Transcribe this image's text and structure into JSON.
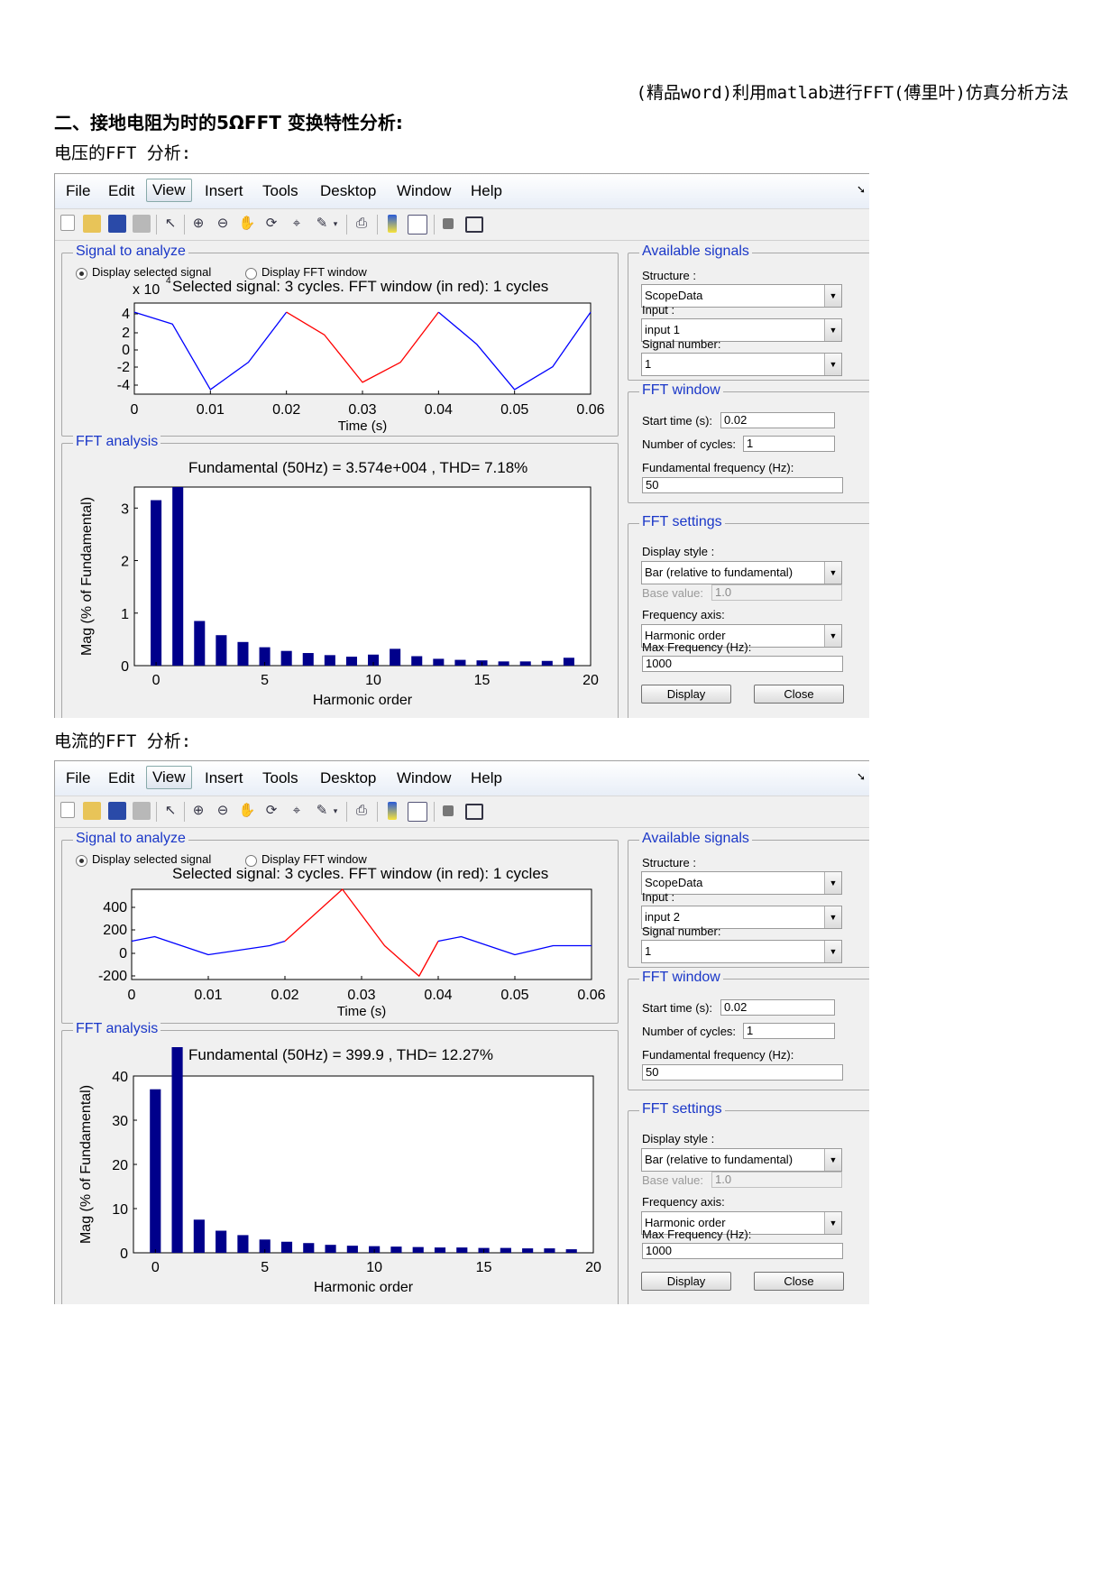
{
  "doc": {
    "header": "(精品word)利用matlab进行FFT(傅里叶)仿真分析方法",
    "heading": "二、接地电阻为时的5ΩFFT 变换特性分析:",
    "captions": [
      "电压的FFT 分析:",
      "电流的FFT 分析:"
    ]
  },
  "common": {
    "menus": [
      "File",
      "Edit",
      "View",
      "Insert",
      "Tools",
      "Desktop",
      "Window",
      "Help"
    ],
    "selected_menu": "View",
    "signal_group": "Signal to analyze",
    "radio_selected": "Display selected signal",
    "radio_fft": "Display FFT window",
    "fft_group": "FFT analysis",
    "available_group": "Available signals",
    "structure_label": "Structure :",
    "input_label": "Input :",
    "signal_number_label": "Signal number:",
    "fft_window_group": "FFT window",
    "start_time_label": "Start time (s):",
    "cycles_label": "Number of cycles:",
    "fund_freq_label": "Fundamental frequency (Hz):",
    "fft_settings_group": "FFT settings",
    "display_style_label": "Display style :",
    "base_value_label": "Base value:",
    "freq_axis_label": "Frequency axis:",
    "max_freq_label": "Max Frequency (Hz):",
    "display_button": "Display",
    "close_button": "Close",
    "time_xlabel": "Time (s)",
    "harm_xlabel": "Harmonic order",
    "harm_ylabel": "Mag (% of Fundamental)",
    "time_ticks": [
      "0",
      "0.01",
      "0.02",
      "0.03",
      "0.04",
      "0.05",
      "0.06"
    ],
    "harm_ticks": [
      "0",
      "5",
      "10",
      "15",
      "20"
    ]
  },
  "windows": [
    {
      "selected_text": "Selected signal: 3 cycles. FFT window (in red): 1 cycles",
      "y_scale_label": "x 10",
      "y_scale_exp": "4",
      "fundamental_text": "Fundamental (50Hz) = 3.574e+004 , THD= 7.18%",
      "structure": "ScopeData",
      "input": "input 1",
      "signal_number": "1",
      "start_time": "0.02",
      "cycles": "1",
      "fund_freq": "50",
      "display_style": "Bar (relative to fundamental)",
      "base_value": "1.0",
      "freq_axis": "Harmonic order",
      "max_freq": "1000"
    },
    {
      "selected_text": "Selected signal: 3 cycles. FFT window (in red): 1 cycles",
      "y_scale_label": "",
      "y_scale_exp": "",
      "fundamental_text": "Fundamental (50Hz) = 399.9 , THD= 12.27%",
      "structure": "ScopeData",
      "input": "input 2",
      "signal_number": "1",
      "start_time": "0.02",
      "cycles": "1",
      "fund_freq": "50",
      "display_style": "Bar (relative to fundamental)",
      "base_value": "1.0",
      "freq_axis": "Harmonic order",
      "max_freq": "1000"
    }
  ],
  "chart_data": [
    {
      "type": "line",
      "title": "Selected signal: 3 cycles. FFT window (in red): 1 cycles",
      "xlabel": "Time (s)",
      "ylabel": "",
      "xlim": [
        0,
        0.06
      ],
      "ylim": [
        -5,
        5
      ],
      "yticks": [
        "4",
        "2",
        "0",
        "-2",
        "-4"
      ],
      "y_multiplier": "x 10^4",
      "series": [
        {
          "color": "#0000ff",
          "x": [
            0,
            0.005,
            0.01,
            0.015,
            0.02
          ],
          "y": [
            4,
            2.7,
            -4.5,
            -1.5,
            4
          ]
        },
        {
          "color": "#ff0000",
          "x": [
            0.02,
            0.025,
            0.03,
            0.035,
            0.04
          ],
          "y": [
            4,
            1.5,
            -3.7,
            -1.5,
            4
          ]
        },
        {
          "color": "#0000ff",
          "x": [
            0.04,
            0.045,
            0.05,
            0.055,
            0.06
          ],
          "y": [
            4,
            0.5,
            -4.5,
            -2,
            4
          ]
        }
      ]
    },
    {
      "type": "bar",
      "title": "Fundamental (50Hz) = 3.574e+004 , THD= 7.18%",
      "xlabel": "Harmonic order",
      "ylabel": "Mag (% of Fundamental)",
      "xlim": [
        -1,
        20
      ],
      "ylim": [
        0,
        3.4
      ],
      "yticks": [
        "3",
        "2",
        "1",
        "0"
      ],
      "categories": [
        0,
        1,
        2,
        3,
        4,
        5,
        6,
        7,
        8,
        9,
        10,
        11,
        12,
        13,
        14,
        15,
        16,
        17,
        18,
        19
      ],
      "values": [
        3.15,
        3.4,
        0.85,
        0.58,
        0.45,
        0.35,
        0.28,
        0.24,
        0.2,
        0.17,
        0.21,
        0.32,
        0.18,
        0.13,
        0.11,
        0.1,
        0.08,
        0.08,
        0.09,
        0.15
      ],
      "clipped_value_note": "bar 1 (fundamental) extends beyond plot top"
    },
    {
      "type": "line",
      "title": "Selected signal: 3 cycles. FFT window (in red): 1 cycles",
      "xlabel": "Time (s)",
      "ylabel": "",
      "xlim": [
        0,
        0.06
      ],
      "ylim": [
        -300,
        500
      ],
      "yticks": [
        "400",
        "200",
        "0",
        "-200"
      ],
      "series": [
        {
          "color": "#0000ff",
          "x": [
            0,
            0.003,
            0.01,
            0.018,
            0.02
          ],
          "y": [
            40,
            80,
            -80,
            0,
            40
          ]
        },
        {
          "color": "#ff0000",
          "x": [
            0.02,
            0.0275,
            0.033,
            0.0375,
            0.04
          ],
          "y": [
            40,
            500,
            0,
            -270,
            40
          ]
        },
        {
          "color": "#0000ff",
          "x": [
            0.04,
            0.043,
            0.05,
            0.055,
            0.06
          ],
          "y": [
            40,
            80,
            -80,
            0,
            0
          ]
        }
      ]
    },
    {
      "type": "bar",
      "title": "Fundamental (50Hz) = 399.9 , THD= 12.27%",
      "xlabel": "Harmonic order",
      "ylabel": "Mag (% of Fundamental)",
      "xlim": [
        -1,
        20
      ],
      "ylim": [
        0,
        40
      ],
      "yticks": [
        "40",
        "30",
        "20",
        "10",
        "0"
      ],
      "categories": [
        0,
        1,
        2,
        3,
        4,
        5,
        6,
        7,
        8,
        9,
        10,
        11,
        12,
        13,
        14,
        15,
        16,
        17,
        18,
        19
      ],
      "values": [
        37,
        48,
        7.5,
        5,
        4,
        3,
        2.5,
        2.2,
        1.8,
        1.6,
        1.5,
        1.4,
        1.3,
        1.2,
        1.2,
        1.1,
        1.1,
        1.0,
        1.0,
        0.8
      ]
    }
  ]
}
